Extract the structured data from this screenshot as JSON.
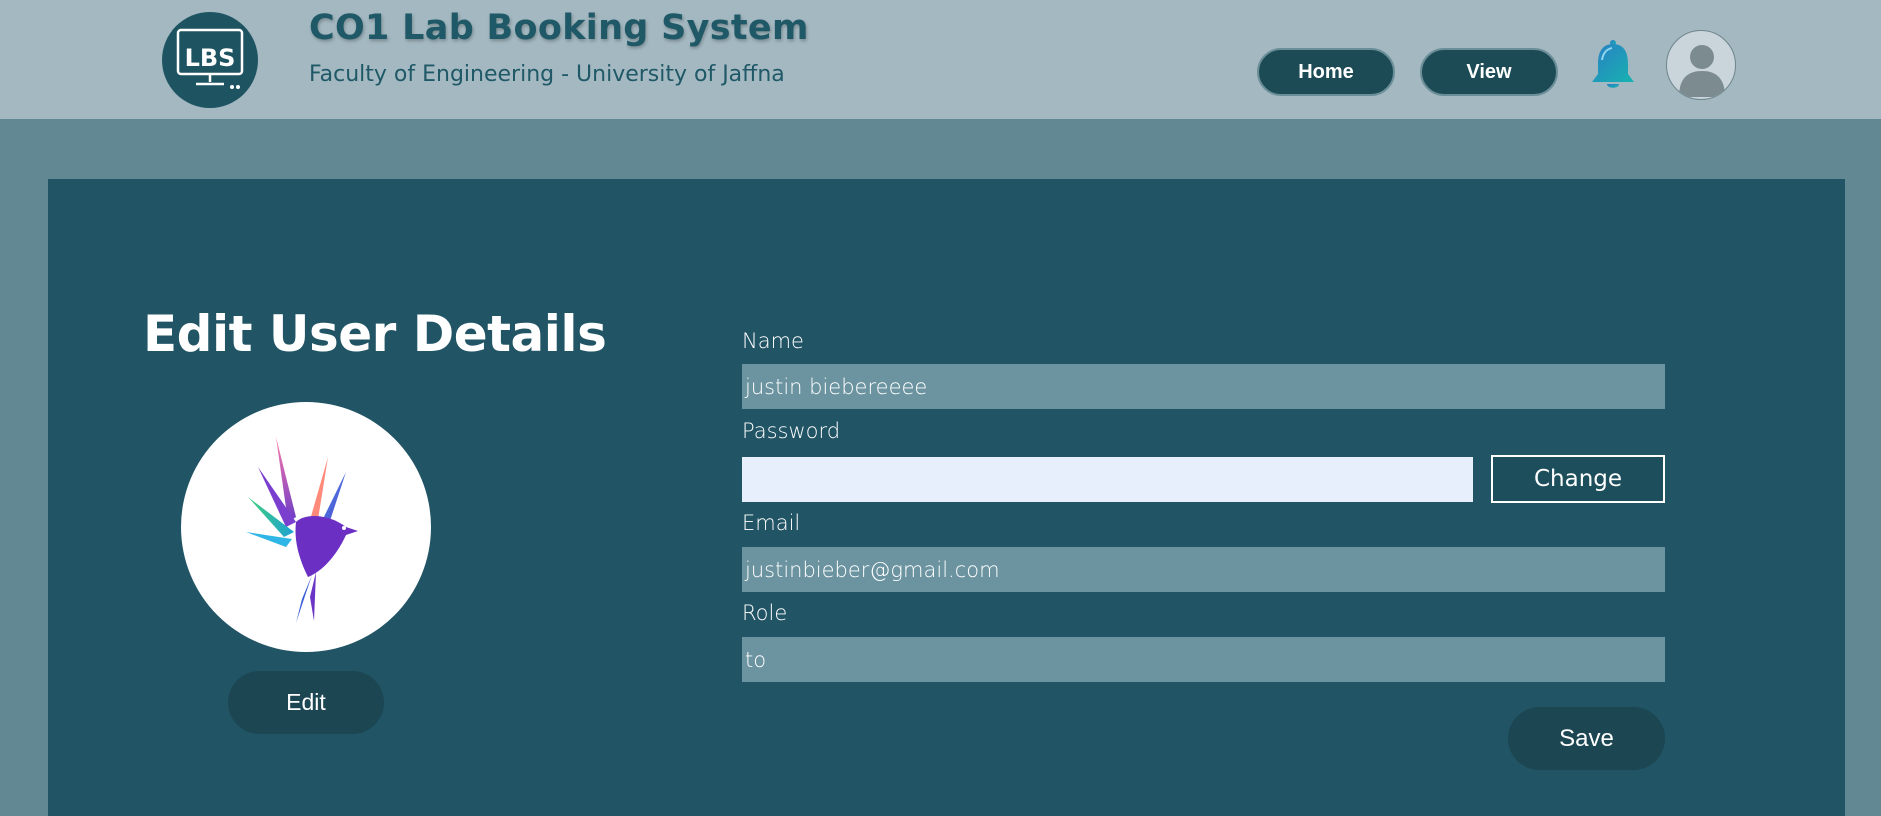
{
  "header": {
    "logo_text": "LBS",
    "title": "CO1 Lab Booking System",
    "subtitle": "Faculty of Engineering - University of Jaffna",
    "nav": {
      "home_label": "Home",
      "view_label": "View"
    },
    "notification_icon": "bell-icon",
    "avatar_icon": "user-avatar-icon"
  },
  "main": {
    "page_title": "Edit User Details",
    "profile_image": "colorful-bird-image",
    "edit_label": "Edit",
    "form": {
      "name_label": "Name",
      "name_value": "justin  biebereeee",
      "password_label": "Password",
      "password_value": "",
      "change_label": "Change",
      "email_label": "Email",
      "email_value": "justinbieber@gmail.com",
      "role_label": "Role",
      "role_value": "to",
      "save_label": "Save"
    }
  },
  "colors": {
    "page_bg": "#628894",
    "header_bg": "#a3b8c1",
    "card_bg": "#215465",
    "button_bg": "#1b4652",
    "input_bg": "#6b93a0",
    "password_bg": "#e8effc",
    "bell": "#1b9bb8"
  }
}
